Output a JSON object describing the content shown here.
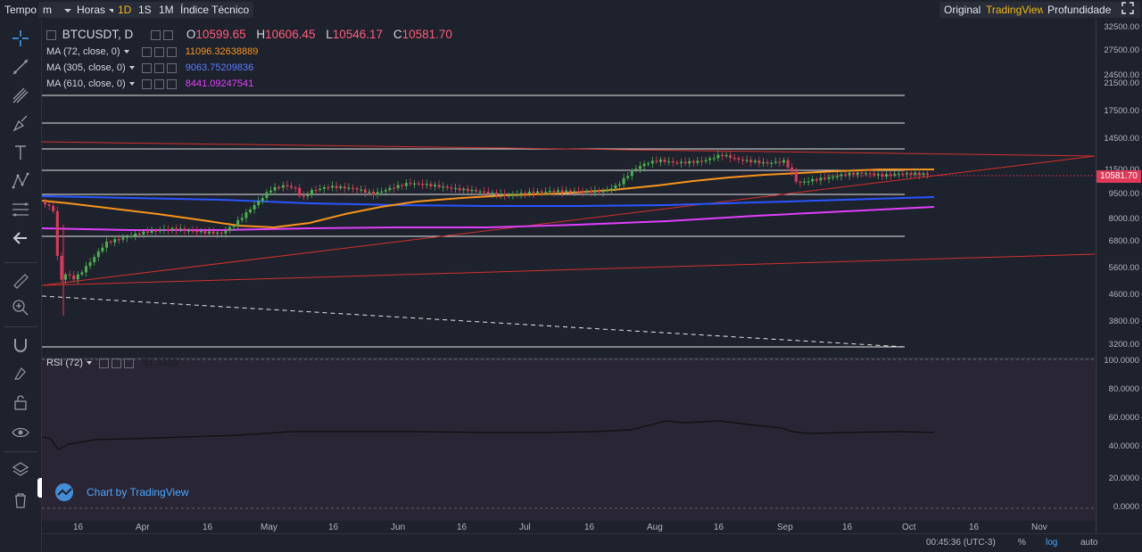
{
  "toolbar": {
    "timeframe_label": "Tempo",
    "interval_value": "m",
    "unit_value": "Horas",
    "intervals": [
      "1D",
      "1S",
      "1M"
    ],
    "active_interval": "1D",
    "indicators_label": "Índice Técnico",
    "views": [
      "Original",
      "TradingView",
      "Profundidade"
    ],
    "active_view": "TradingView"
  },
  "symbol": {
    "title": "BTCUSDT, D",
    "open_label": "O",
    "open": "10599.65",
    "high_label": "H",
    "high": "10606.45",
    "low_label": "L",
    "low": "10546.17",
    "close_label": "C",
    "close": "10581.70"
  },
  "indicators": [
    {
      "label": "MA (72, close, 0)",
      "value": "11096.32638889",
      "color": "#f7941d"
    },
    {
      "label": "MA (305, close, 0)",
      "value": "9063.75209836",
      "color": "#2a55ff"
    },
    {
      "label": "MA (610, close, 0)",
      "value": "8441.09247541",
      "color": "#e040fb"
    }
  ],
  "rsi": {
    "label": "RSI (72)",
    "value": "51.3329"
  },
  "price_axis": [
    "32500.00",
    "27500.00",
    "24500.00",
    "21500.00",
    "17500.00",
    "14500.00",
    "11500.00",
    "9500.00",
    "8000.00",
    "6800.00",
    "5600.00",
    "4600.00",
    "3800.00",
    "3200.00"
  ],
  "current_price": "10581.70",
  "rsi_axis": [
    "100.0000",
    "80.0000",
    "60.0000",
    "40.0000",
    "20.0000",
    "0.0000"
  ],
  "time_axis": [
    "16",
    "Apr",
    "16",
    "May",
    "16",
    "Jun",
    "16",
    "Jul",
    "16",
    "Aug",
    "16",
    "Sep",
    "16",
    "Oct",
    "16",
    "Nov"
  ],
  "watermark": "Chart by TradingView",
  "bottom": {
    "clock": "00:45:36 (UTC-3)",
    "percent": "%",
    "log": "log",
    "auto": "auto"
  },
  "colors": {
    "up": "#4caf50",
    "down": "#e03a5a",
    "ma72": "#f7941d",
    "ma305": "#2a55ff",
    "ma610": "#e040fb",
    "trend": "#d32f2f"
  },
  "chart_data": {
    "type": "candlestick",
    "symbol": "BTCUSDT",
    "interval": "D",
    "scale": "log",
    "ylim": [
      3000,
      33000
    ],
    "rsi_ylim": [
      0,
      100
    ]
  }
}
